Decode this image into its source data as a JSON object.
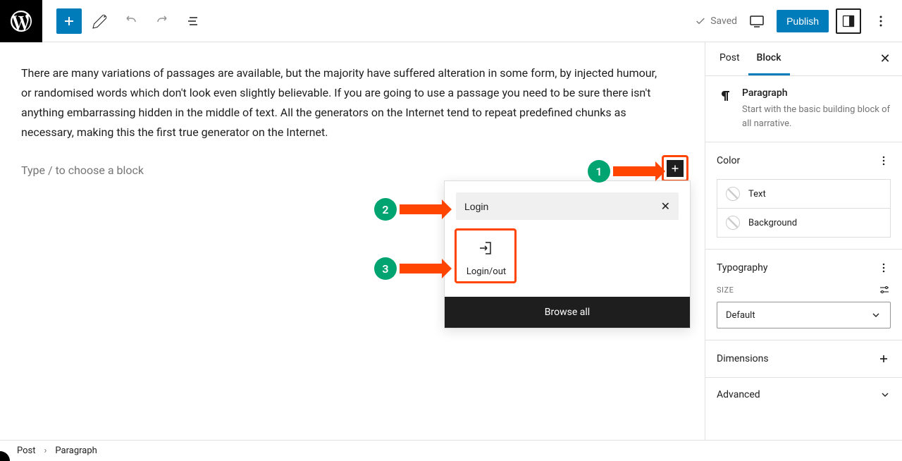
{
  "toolbar": {
    "saved_label": "Saved",
    "publish_label": "Publish"
  },
  "editor": {
    "paragraph": "There are many variations of passages are available, but the majority have suffered alteration in some form, by injected humour, or randomised words which don't look even slightly believable. If you are going to use a passage you need to be sure there isn't anything embarrassing hidden in the middle of text. All the generators on the Internet tend to repeat predefined chunks as necessary, making this the first true generator on the Internet.",
    "placeholder": "Type / to choose a block"
  },
  "annotations": {
    "step1": "1",
    "step2": "2",
    "step3": "3"
  },
  "inserter": {
    "search_value": "Login",
    "block_label": "Login/out",
    "browse_all": "Browse all"
  },
  "sidebar": {
    "tab_post": "Post",
    "tab_block": "Block",
    "block_title": "Paragraph",
    "block_desc": "Start with the basic building block of all narrative.",
    "panel_color": "Color",
    "color_text": "Text",
    "color_background": "Background",
    "panel_typography": "Typography",
    "size_label": "SIZE",
    "size_value": "Default",
    "panel_dimensions": "Dimensions",
    "panel_advanced": "Advanced"
  },
  "breadcrumb": {
    "item1": "Post",
    "item2": "Paragraph"
  }
}
